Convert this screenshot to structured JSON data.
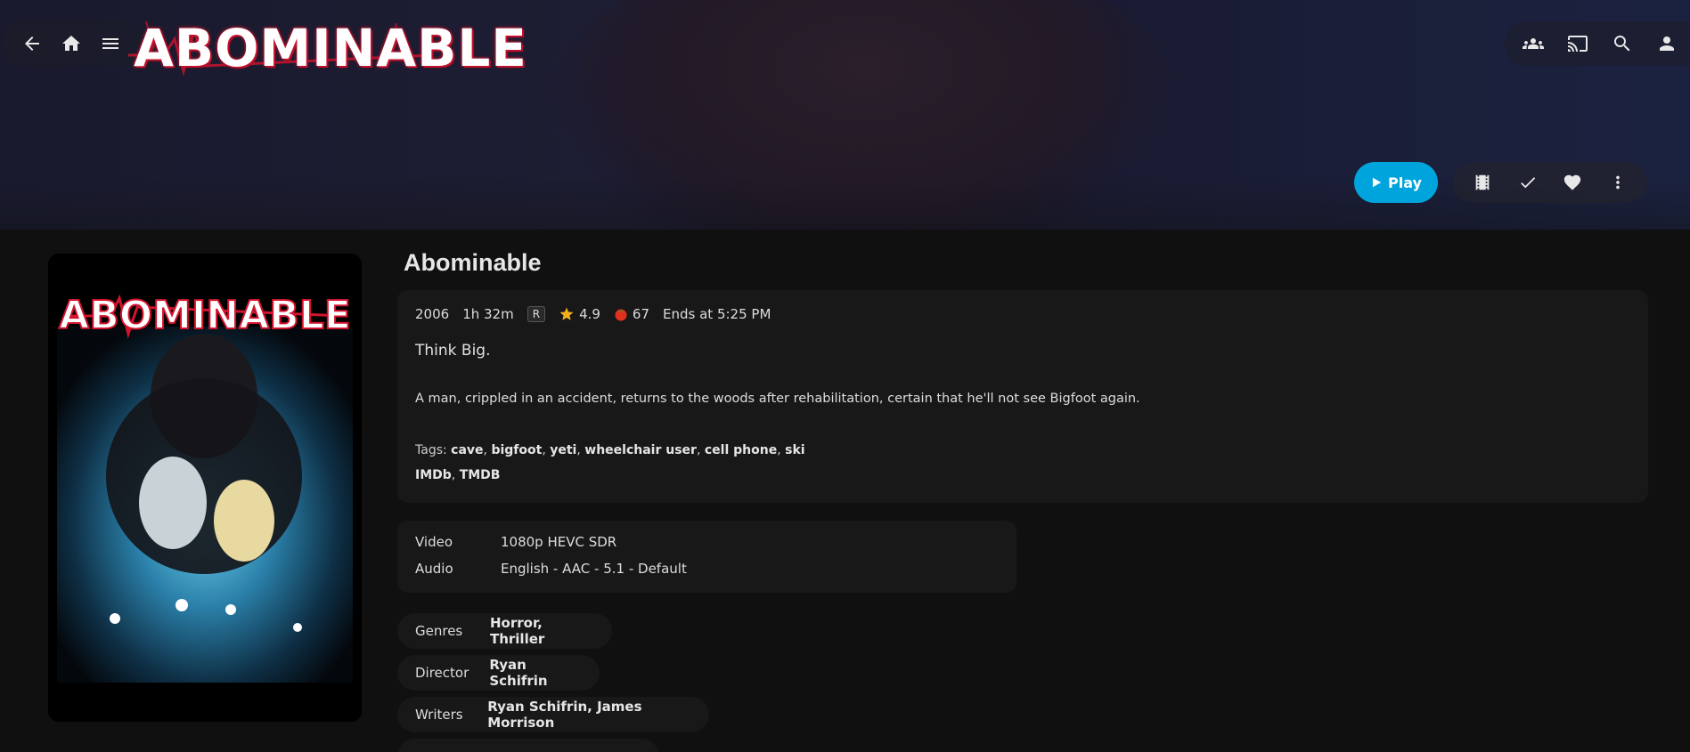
{
  "header": {
    "logo_text": "ABOMINABLE",
    "left_icons": [
      "back-arrow-icon",
      "home-icon",
      "menu-icon"
    ],
    "right_icons": [
      "people-icon",
      "cast-icon",
      "search-icon",
      "user-icon"
    ]
  },
  "actions": {
    "play_label": "Play",
    "icons": [
      "trailer-icon",
      "check-icon",
      "heart-icon",
      "more-vertical-icon"
    ],
    "accent": "#00a4dc"
  },
  "movie": {
    "title": "Abominable",
    "year": "2006",
    "runtime": "1h 32m",
    "rating": "R",
    "community_rating": "4.9",
    "critic_rating": "67",
    "ends_at": "Ends at 5:25 PM",
    "tagline": "Think Big.",
    "overview": "A man, crippled in an accident, returns to the woods after rehabilitation, certain that he'll not see Bigfoot again.",
    "tags_label": "Tags:",
    "tags": [
      "cave",
      "bigfoot",
      "yeti",
      "wheelchair user",
      "cell phone",
      "ski"
    ],
    "links": [
      "IMDb",
      "TMDB"
    ],
    "poster_title": "ABOMINABLE"
  },
  "media": {
    "video_label": "Video",
    "video_value": "1080p HEVC SDR",
    "audio_label": "Audio",
    "audio_value": "English - AAC - 5.1 - Default"
  },
  "details": {
    "genres_label": "Genres",
    "genres": [
      "Horror",
      "Thriller"
    ],
    "director_label": "Director",
    "director": "Ryan Schifrin",
    "writers_label": "Writers",
    "writers": [
      "Ryan Schifrin",
      "James Morrison"
    ]
  },
  "colors": {
    "background": "#101010",
    "card": "#181818",
    "star": "#f2b01e",
    "tomato": "#e0311e",
    "logo_red": "#d3142e"
  }
}
